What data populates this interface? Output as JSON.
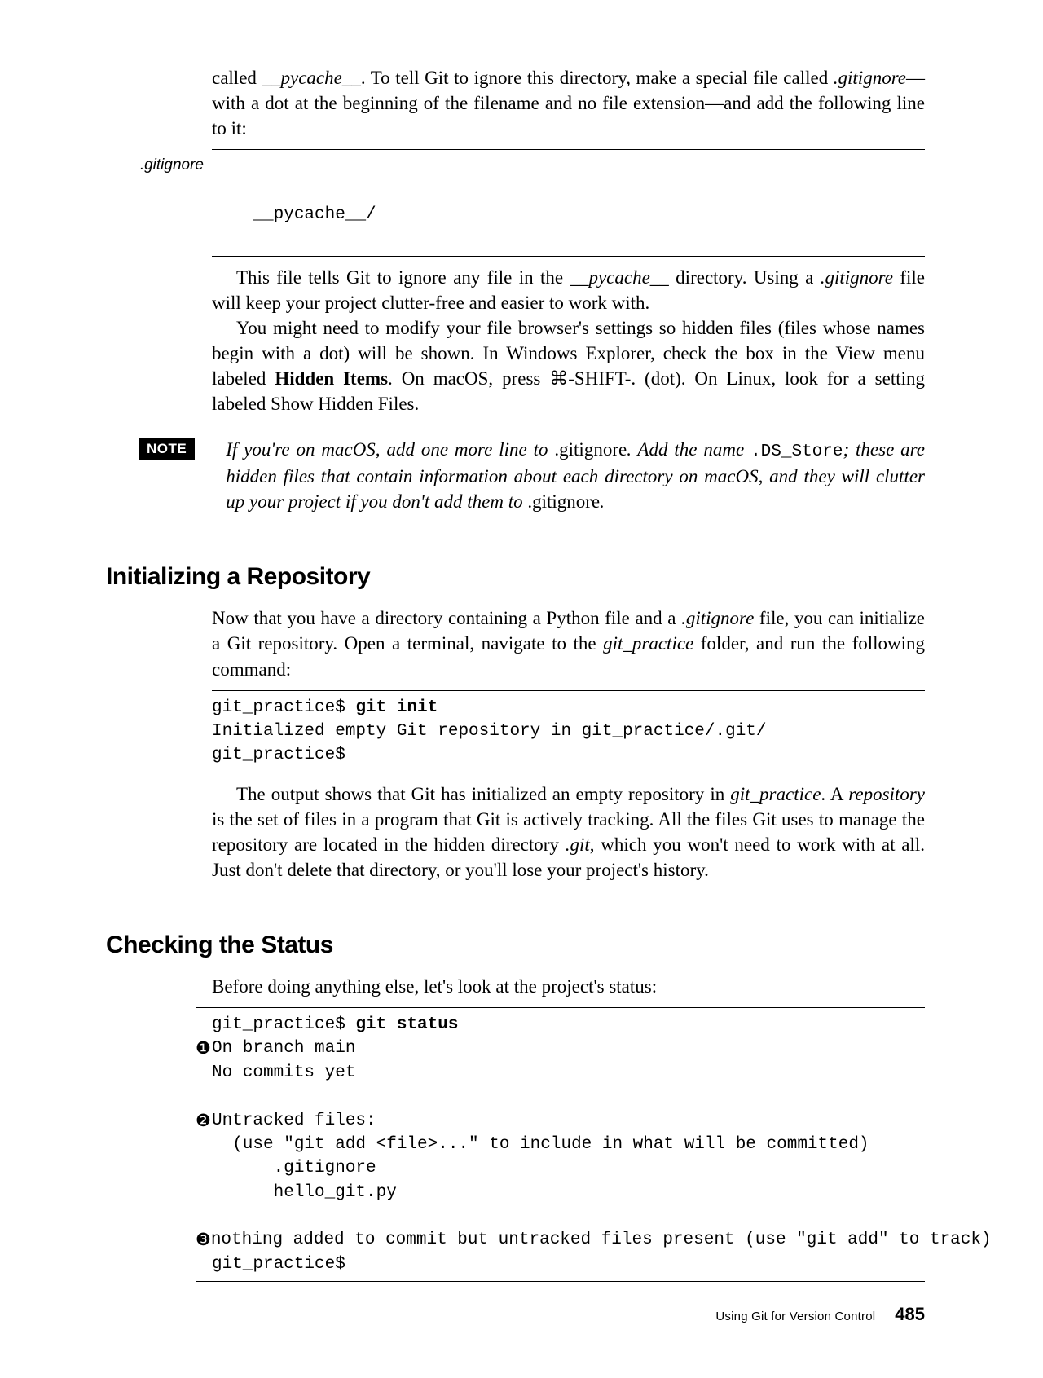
{
  "intro": {
    "para1_parts": [
      "called ",
      "__pycache__",
      ". To tell Git to ignore this directory, make a special file called ",
      ".gitignore",
      "—with a dot at the beginning of the filename and no file extension—and add the following line to it:"
    ]
  },
  "gitignore_block": {
    "label": ".gitignore",
    "content": "__pycache__/"
  },
  "after_gitignore": {
    "p1_a": "This file tells Git to ignore any file in the ",
    "p1_b": "__pycache__",
    "p1_c": " directory. Using a ",
    "p1_d": ".gitignore",
    "p1_e": " file will keep your project clutter-free and easier to work with.",
    "p2_a": "You might need to modify your file browser's settings so hidden files (files whose names begin with a dot) will be shown. In Windows Explorer, check the box in the View menu labeled ",
    "p2_b": "Hidden Items",
    "p2_c": ". On macOS, press ",
    "p2_d": "⌘",
    "p2_e": "-SHIFT-. (dot). On Linux, look for a setting labeled Show Hidden Files."
  },
  "note": {
    "badge": "NOTE",
    "t1": "If you're on macOS, add one more line to ",
    "t2": ".gitignore",
    "t3": ". Add the name ",
    "t4": ".DS_Store",
    "t5": "; these are hidden files that contain information about each directory on macOS, and they will clutter up your project if you don't add them to ",
    "t6": ".gitignore",
    "t7": "."
  },
  "section1": {
    "heading": "Initializing a Repository",
    "p1_a": "Now that you have a directory containing a Python file and a ",
    "p1_b": ".gitignore",
    "p1_c": " file, you can initialize a Git repository. Open a terminal, navigate to the ",
    "p1_d": "git_practice",
    "p1_e": " folder, and run the following command:",
    "code": {
      "line1_a": "git_practice$ ",
      "line1_b": "git init",
      "line2": "Initialized empty Git repository in git_practice/.git/",
      "line3": "git_practice$"
    },
    "p2_a": "The output shows that Git has initialized an empty repository in ",
    "p2_b": "git_practice",
    "p2_c": ". A ",
    "p2_d": "repository",
    "p2_e": " is the set of files in a program that Git is actively tracking. All the files Git uses to manage the repository are located in the hidden directory ",
    "p2_f": ".git",
    "p2_g": ", which you won't need to work with at all. Just don't delete that directory, or you'll lose your project's history."
  },
  "section2": {
    "heading": "Checking the Status",
    "p1": "Before doing anything else, let's look at the project's status:",
    "code": {
      "l1_a": "git_practice$ ",
      "l1_b": "git status",
      "c1": "❶",
      "l2": "On branch main",
      "l3": "No commits yet",
      "c2": "❷",
      "l5": "Untracked files:",
      "l6": "  (use \"git add <file>...\" to include in what will be committed)",
      "l7": "      .gitignore",
      "l8": "      hello_git.py",
      "c3": "❸",
      "l10": "nothing added to commit but untracked files present (use \"git add\" to track)",
      "l11": "git_practice$"
    }
  },
  "footer": {
    "chapter": "Using Git for Version Control",
    "page": "485"
  }
}
